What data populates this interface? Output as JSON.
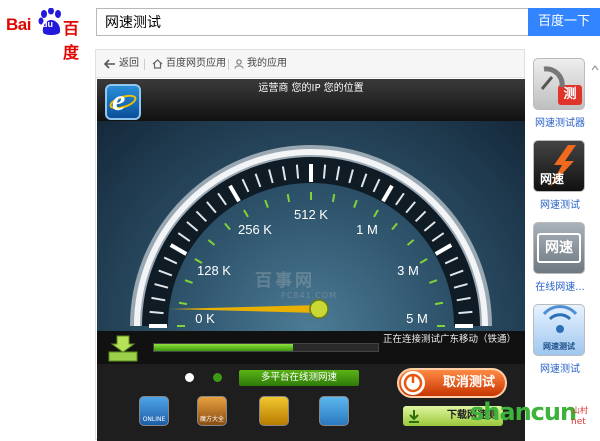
{
  "brand": {
    "logo_latin": "Bai",
    "logo_du": "du",
    "logo_cn": "百度"
  },
  "search": {
    "query": "网速测试",
    "button_label": "百度一下"
  },
  "nav": {
    "back": "返回",
    "web_apps": "百度网页应用",
    "my_apps": "我的应用"
  },
  "widget": {
    "header_text": "运营商 您的IP 您的位置",
    "gauge_labels": [
      "0 K",
      "128 K",
      "256 K",
      "512 K",
      "1 M",
      "3 M",
      "5 M"
    ],
    "needle_value": "0 K",
    "progress_fraction": 0.62,
    "status_text": "正在连接测试广东移动（铁通）",
    "multi_platform": "多平台在线测网速",
    "cancel_button": "取消测试",
    "download_button": "下载网速测",
    "watermark_cn": "百事网",
    "watermark_url": "PC841.COM",
    "apps": [
      {
        "name": "bluebook-app",
        "tile_text": "ONLINE"
      },
      {
        "name": "cube-app",
        "tile_text": "魔方大全"
      },
      {
        "name": "clock-app",
        "tile_text": ""
      },
      {
        "name": "frog-app",
        "tile_text": ""
      }
    ]
  },
  "sidebar": {
    "items": [
      {
        "label": "网速测试器",
        "tile_text": "测"
      },
      {
        "label": "网速测试",
        "tile_text": "网速"
      },
      {
        "label": "在线网速...",
        "tile_text": "网速"
      },
      {
        "label": "网速测试",
        "tile_text": "网速测试"
      }
    ]
  },
  "footer_watermark": {
    "text": "shancun",
    "tag": "山村",
    "net": "net"
  },
  "colors": {
    "accent": "#3385ff",
    "logo_red": "#e10602",
    "link_blue": "#2a62c9",
    "gauge_green": "#7fd43a",
    "cancel_orange": "#e8570d"
  }
}
